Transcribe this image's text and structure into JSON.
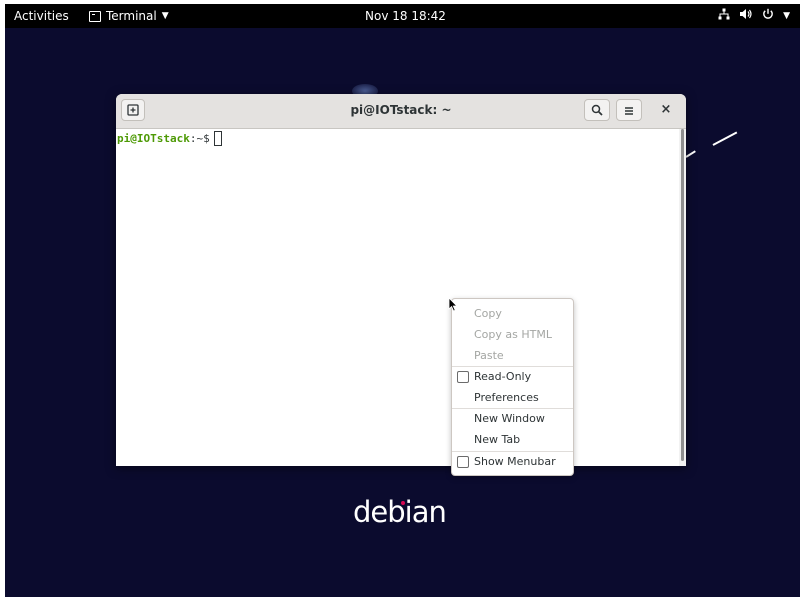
{
  "topbar": {
    "activities_label": "Activities",
    "app_name": "Terminal",
    "clock": "Nov 18  18:42",
    "icons": [
      "network-icon",
      "volume-icon",
      "power-icon"
    ]
  },
  "window": {
    "title": "pi@IOTstack: ~",
    "new_tab_icon": "new-tab-icon",
    "search_icon": "search-icon",
    "menu_icon": "hamburger-menu-icon",
    "close_label": "×"
  },
  "terminal": {
    "user_host": "pi@IOTstack",
    "prompt_suffix": ":~$"
  },
  "context_menu": {
    "items": [
      {
        "label": "Copy",
        "enabled": false,
        "checkbox": false
      },
      {
        "label": "Copy as HTML",
        "enabled": false,
        "checkbox": false
      },
      {
        "label": "Paste",
        "enabled": false,
        "checkbox": false
      },
      {
        "label": "Read-Only",
        "enabled": true,
        "checkbox": true,
        "checked": false
      },
      {
        "label": "Preferences",
        "enabled": true,
        "checkbox": false
      },
      {
        "label": "New Window",
        "enabled": true,
        "checkbox": false
      },
      {
        "label": "New Tab",
        "enabled": true,
        "checkbox": false
      },
      {
        "label": "Show Menubar",
        "enabled": true,
        "checkbox": true,
        "checked": false
      }
    ]
  },
  "desktop": {
    "logo_text": "debian"
  },
  "colors": {
    "desktop_bg": "#0b0b2e",
    "prompt_green": "#4e9a06",
    "debian_red": "#d70751",
    "titlebar": "#e4e2e0"
  }
}
